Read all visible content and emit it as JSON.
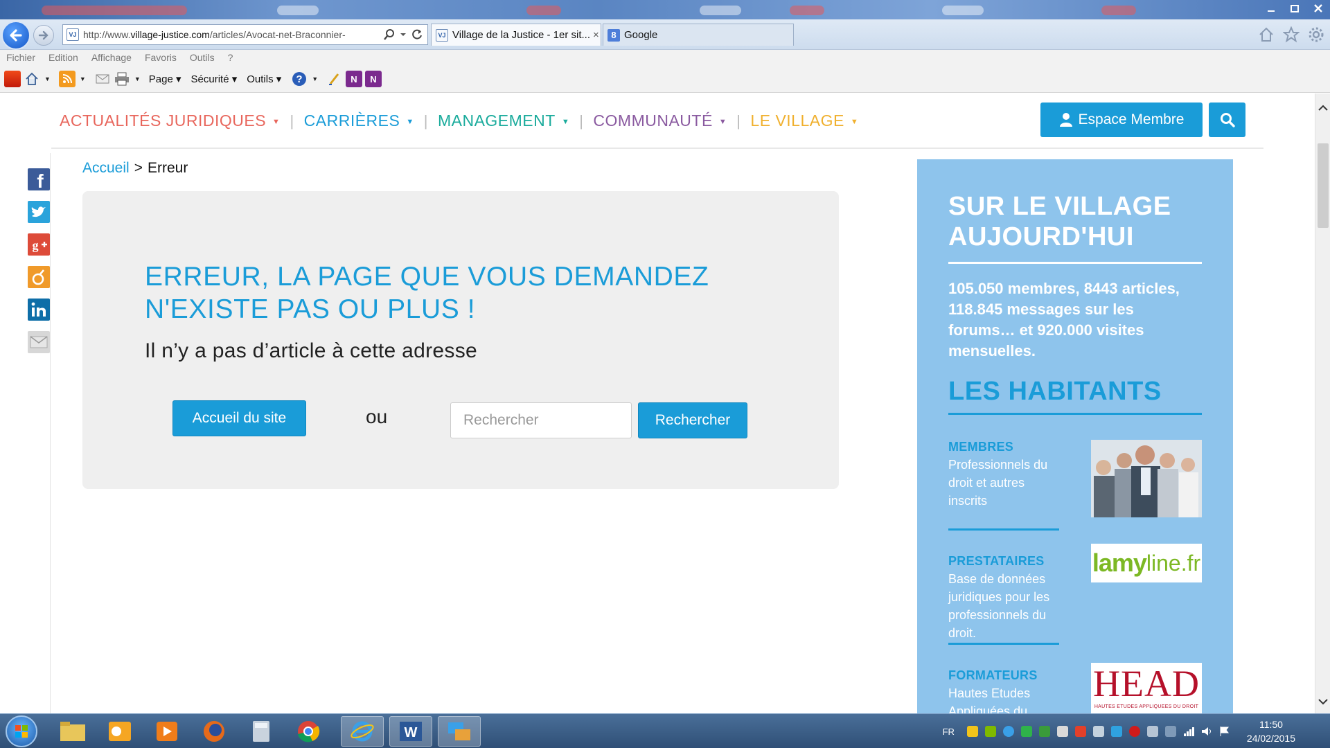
{
  "browser": {
    "address_url_prefix": "http://www.",
    "address_url_domain": "village-justice.com",
    "address_url_path": "/articles/Avocat-net-Braconnier-",
    "tabs": [
      {
        "favicon": "VJ",
        "label": "Village de la Justice - 1er sit...",
        "close": "×"
      },
      {
        "favicon": "8",
        "label": "Google"
      }
    ],
    "menu": [
      "Fichier",
      "Edition",
      "Affichage",
      "Favoris",
      "Outils",
      "?"
    ],
    "commands": {
      "page": "Page",
      "security": "Sécurité",
      "tools": "Outils"
    }
  },
  "site": {
    "nav": [
      {
        "label": "ACTUALITÉS JURIDIQUES",
        "color": "#e8665c"
      },
      {
        "label": "CARRIÈRES",
        "color": "#1a9cd8"
      },
      {
        "label": "MANAGEMENT",
        "color": "#1aab9c"
      },
      {
        "label": "COMMUNAUTÉ",
        "color": "#8a5aa0"
      },
      {
        "label": "LE VILLAGE",
        "color": "#f0b02e"
      }
    ],
    "member_button": "Espace Membre",
    "accent_color": "#1a9cd8"
  },
  "breadcrumb": {
    "home": "Accueil",
    "separator": ">",
    "current": "Erreur"
  },
  "error": {
    "title": "ERREUR, LA PAGE QUE VOUS DEMANDEZ N'EXISTE PAS OU PLUS !",
    "subtitle": "Il n’y a pas d’article à cette adresse",
    "home_button": "Accueil du site",
    "or_text": "ou",
    "search_placeholder": "Rechercher",
    "search_button": "Rechercher"
  },
  "sidebar": {
    "title": "SUR LE VILLAGE AUJOURD'HUI",
    "stats": "105.050 membres, 8443 articles, 118.845 messages sur les forums… et 920.000 visites mensuelles.",
    "habitants_title": "LES HABITANTS",
    "categories": [
      {
        "name": "MEMBRES",
        "desc": "Professionnels du droit et autres inscrits"
      },
      {
        "name": "PRESTATAIRES",
        "desc": "Base de données juridiques pour les professionnels du droit.",
        "logo_text_a": "lamy",
        "logo_text_b": "line.fr"
      },
      {
        "name": "FORMATEURS",
        "desc": "Hautes Etudes Appliquées du",
        "logo_text": "HEAD",
        "logo_sub": "HAUTES ETUDES APPLIQUEES DU DROIT"
      }
    ]
  },
  "taskbar": {
    "lang": "FR",
    "time": "11:50",
    "date": "24/02/2015"
  }
}
